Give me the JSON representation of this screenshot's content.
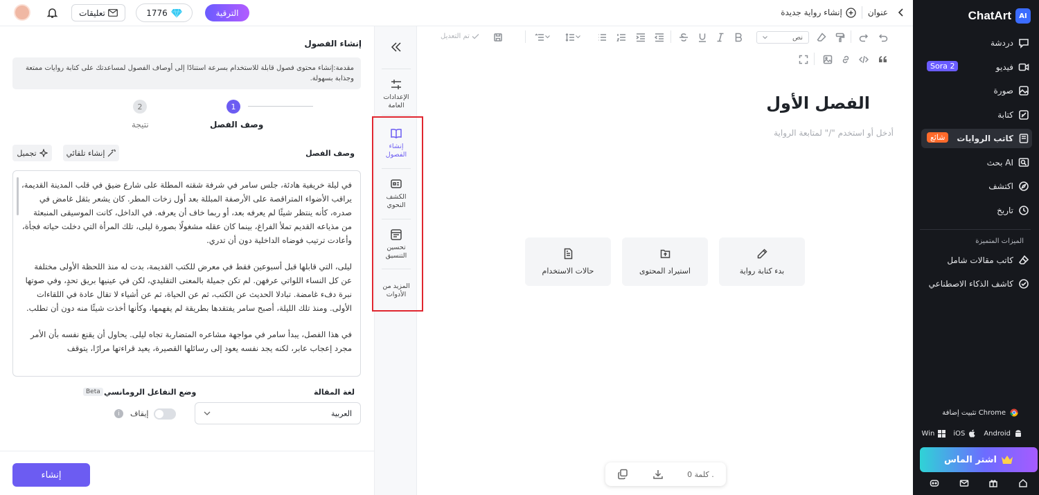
{
  "sidebar": {
    "brand": "ChatArt",
    "logo_text": "AI",
    "items": [
      {
        "label": "دردشة",
        "icon": "chat-icon"
      },
      {
        "label": "فيديو",
        "icon": "video-icon",
        "badge": "Sora 2",
        "badge_color": "#6a5cff"
      },
      {
        "label": "صورة",
        "icon": "image-icon"
      },
      {
        "label": "كتابة",
        "icon": "pen-icon"
      },
      {
        "label": "كاتب الروايات",
        "icon": "book-icon",
        "badge": "شائع",
        "badge_color": "#ff6a2b"
      },
      {
        "label": "بحث AI",
        "icon": "search-icon"
      },
      {
        "label": "اكتشف",
        "icon": "compass-icon"
      },
      {
        "label": "تاريخ",
        "icon": "history-icon"
      }
    ],
    "features_title": "الميزات المتميزة",
    "features": [
      {
        "label": "كاتب مقالات شامل",
        "icon": "eraser-icon"
      },
      {
        "label": "كاشف الذكاء الاصطناعي",
        "icon": "check-circle-icon"
      }
    ],
    "install_label": "تثبيت إضافة Chrome",
    "platforms": [
      "Win",
      "iOS",
      "Android"
    ],
    "buy_label": "اشتر الماس"
  },
  "topbar": {
    "title_label": "عنوان",
    "new_novel_label": "إنشاء رواية جديدة",
    "upgrade_label": "الترقية",
    "gems_count": "1776",
    "notifications_label": "تعليقات"
  },
  "left": {
    "title": "إنشاء الفصول",
    "intro": "مقدمة:إنشاء محتوى فصول قابلة للاستخدام بسرعة استنادًا إلى أوصاف الفصول لمساعدتك على كتابة روايات ممتعة وجذابة بسهولة.",
    "steps": [
      {
        "num": "1",
        "label": "وصف الفصل"
      },
      {
        "num": "2",
        "label": "نتيجة"
      }
    ],
    "desc_label": "وصف الفصل",
    "auto_create_label": "إنشاء تلقائي",
    "beautify_label": "تجميل",
    "paragraphs": [
      "في ليلة خريفية هادئة، جلس سامر في شرفة شقته المطلة على شارع ضيق في قلب المدينة القديمة، يراقب الأضواء المتراقصة على الأرصفة المبللة بعد أول زخات المطر. كان يشعر بثقل غامض في صدره، كأنه ينتظر شيئًا لم يعرفه بعد، أو ربما خاف أن يعرفه. في الداخل، كانت الموسيقى المنبعثة من مذياعه القديم تملأ الفراغ، بينما كان عقله مشغولًا بصورة ليلى، تلك المرأة التي دخلت حياته فجأة، وأعادت ترتيب فوضاه الداخلية دون أن تدري.",
      "ليلى، التي قابلها قبل أسبوعين فقط في معرض للكتب القديمة، بدت له منذ اللحظة الأولى مختلفة عن كل النساء اللواتي عرفهن. لم تكن جميلة بالمعنى التقليدي، لكن في عينيها بريق تحدٍ، وفي صوتها نبرة دفء غامضة. تبادلا الحديث عن الكتب، ثم عن الحياة، ثم عن أشياء لا تقال عادة في اللقاءات الأولى. ومنذ تلك الليلة، أصبح سامر يفتقدها بطريقة لم يفهمها، وكأنها أخذت شيئًا منه دون أن تطلب.",
      "في هذا الفصل، يبدأ سامر في مواجهة مشاعره المتضاربة تجاه ليلى. يحاول أن يقنع نفسه بأن الأمر مجرد إعجاب عابر، لكنه يجد نفسه يعود إلى رسائلها القصيرة، يعيد قراءتها مرارًا، يتوقف"
    ],
    "lang_label": "لغة المقالة",
    "lang_value": "العربية",
    "romance_label": "وضع التفاعل الرومانسي",
    "beta_label": "Beta",
    "toggle_label": "إيقاف",
    "create_label": "إنشاء"
  },
  "tools": [
    {
      "label": "الإعدادات العامة",
      "icon": "sliders-icon"
    },
    {
      "label": "إنشاء الفصول",
      "icon": "open-book-icon"
    },
    {
      "label": "الكشف النحوي",
      "icon": "grammar-icon"
    },
    {
      "label": "تحسين التنسيق",
      "icon": "format-icon"
    },
    {
      "label": "المزيد من الأدوات",
      "icon": ""
    }
  ],
  "editor": {
    "font_select": "نص",
    "saved_label": "تم التعديل",
    "chapter_title": "الفصل الأول",
    "placeholder": "أدخل أو استخدم \"/\" لمتابعة الرواية",
    "cards": [
      {
        "label": "بدء كتابة رواية",
        "icon": "pencil-icon"
      },
      {
        "label": "استيراد المحتوى",
        "icon": "upload-icon"
      },
      {
        "label": "حالات الاستخدام",
        "icon": "document-icon"
      }
    ],
    "word_count": "0 كلمة ."
  }
}
